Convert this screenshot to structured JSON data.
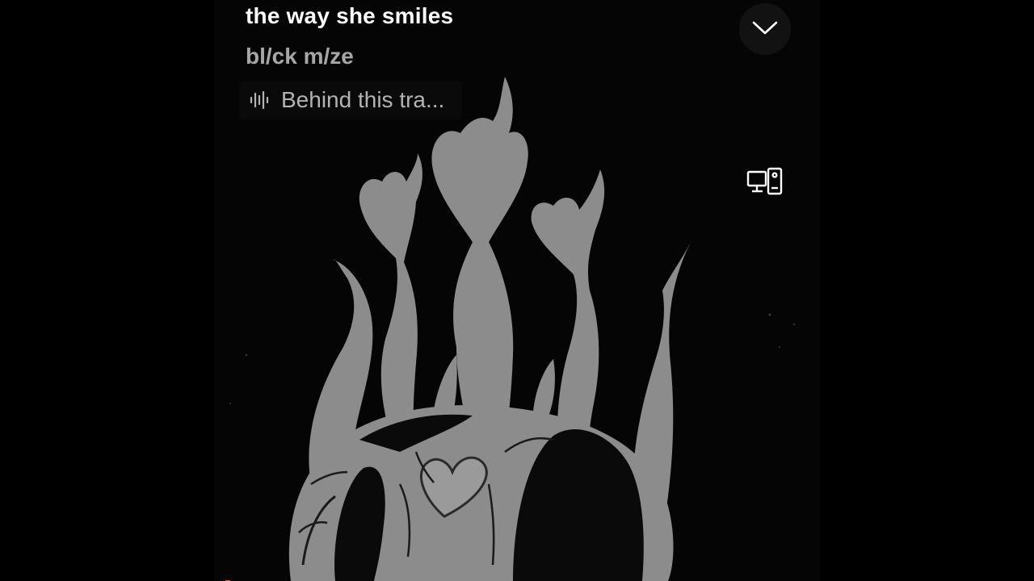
{
  "track": {
    "title": "the way she smiles",
    "artist": "bl/ck m/ze"
  },
  "behind_the_track": {
    "label": "Behind this tra...",
    "icon": "audio-waveform-icon"
  },
  "controls": {
    "collapse_icon": "chevron-down-icon",
    "device_icon": "connect-to-device-icon"
  },
  "artwork": {
    "description_icon": "album-artwork",
    "colors": {
      "background": "#050505",
      "ink": "#8c8c8c",
      "shadow": "#0a0a0a",
      "accent": "#e2552d"
    }
  }
}
